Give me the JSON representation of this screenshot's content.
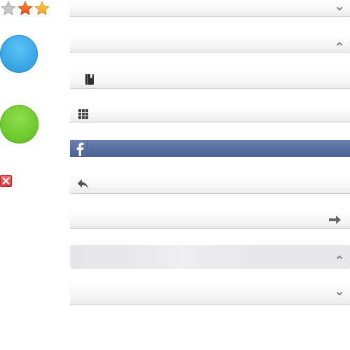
{
  "rating": {
    "value": 2,
    "max": 3
  },
  "colors": {
    "star_empty": "#b9b9b9",
    "star_orange": "#f26b1b",
    "star_gold": "#f6b12a",
    "circle_blue": "#3aa8e6",
    "circle_green": "#6fcb2e",
    "close_red": "#e04848",
    "facebook": "#58709f"
  },
  "icons": {
    "star_empty": "star-empty-icon",
    "star_orange": "star-filled-icon",
    "star_gold": "star-half-icon",
    "close": "close-icon",
    "book": "book-icon",
    "grid": "grid-icon",
    "facebook": "facebook-icon",
    "reply": "reply-icon",
    "arrow_right": "arrow-right-icon",
    "chevron_down": "chevron-down-icon",
    "chevron_up": "chevron-up-icon"
  }
}
